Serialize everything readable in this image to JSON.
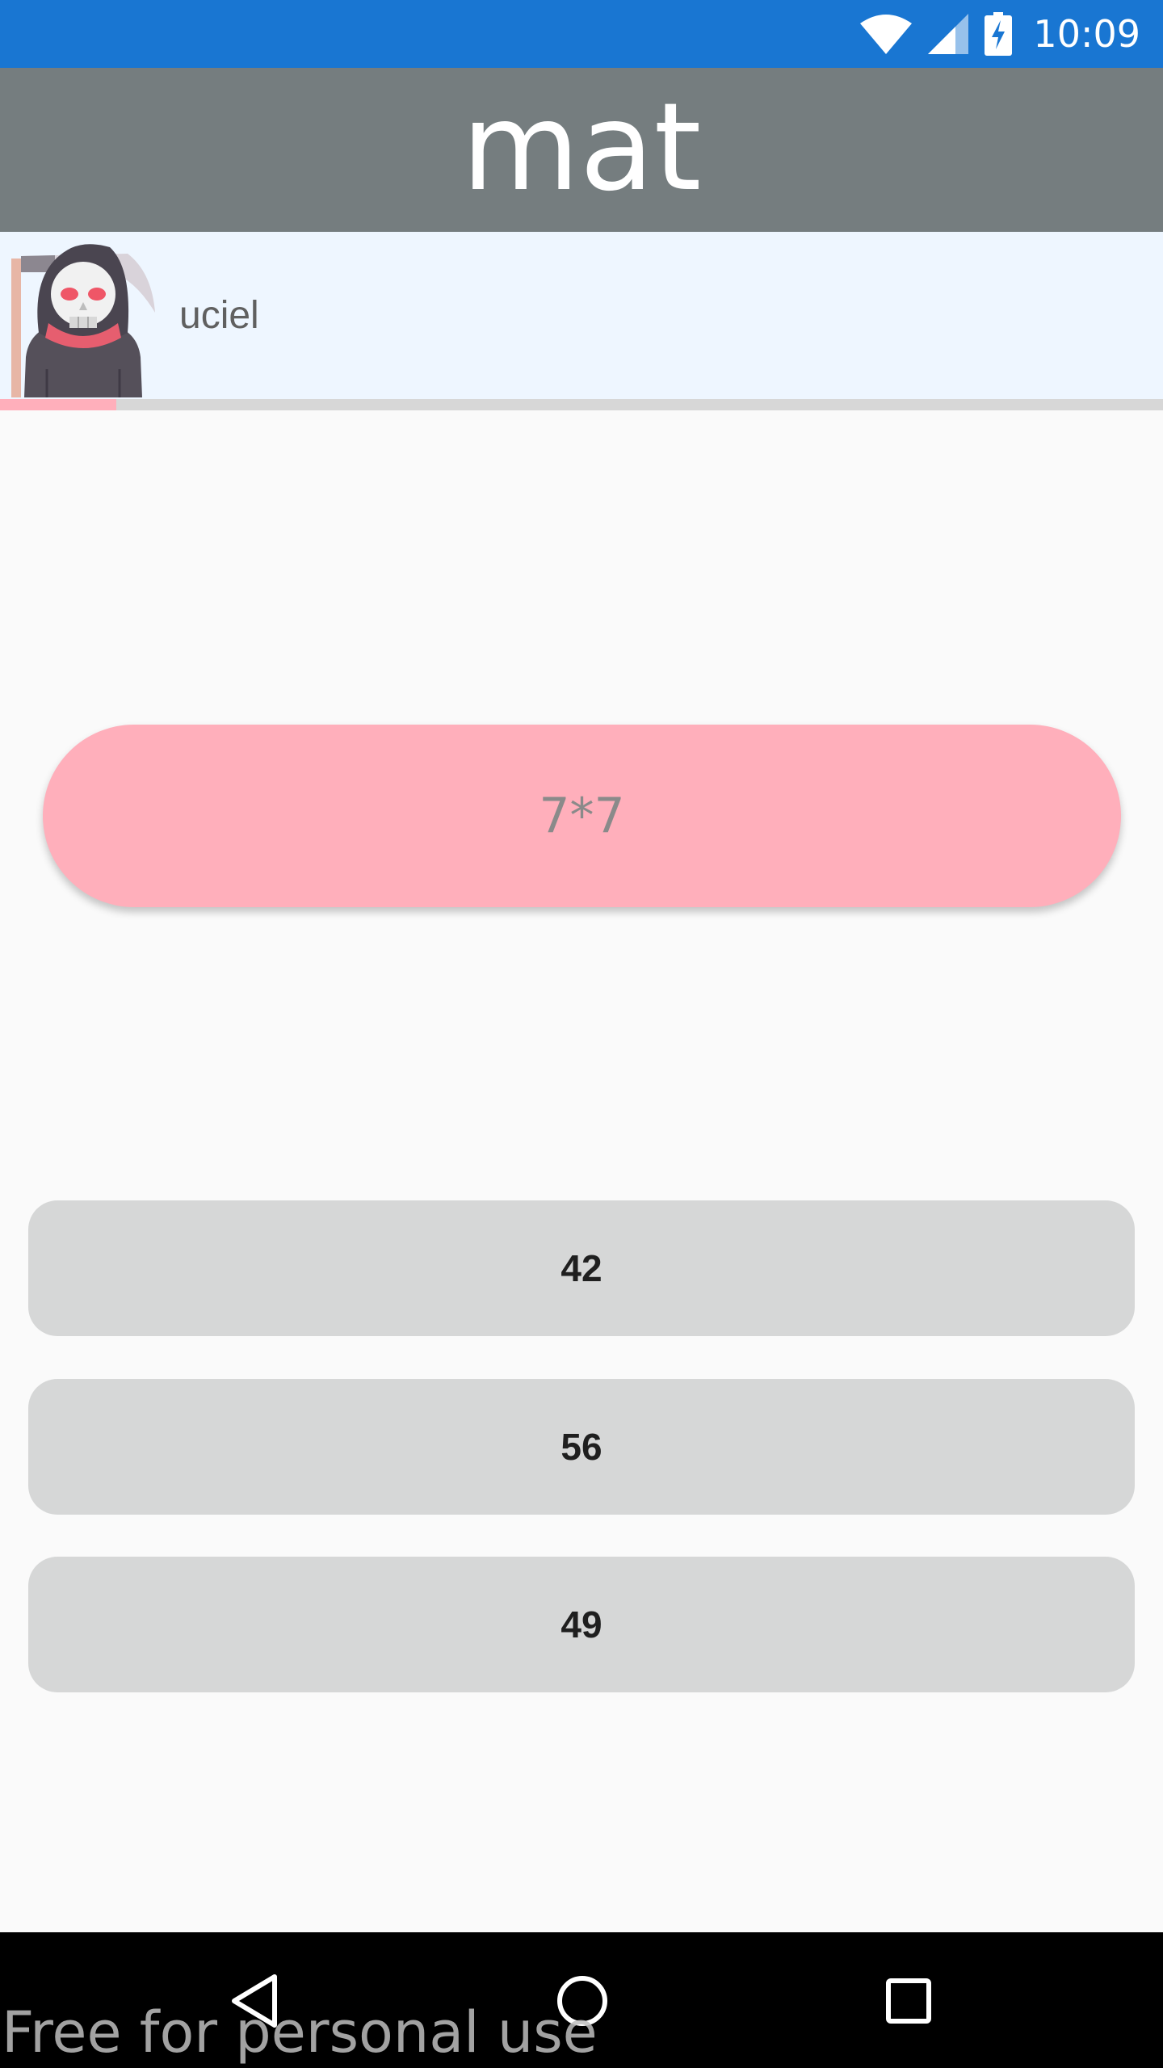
{
  "status_bar": {
    "time": "10:09",
    "icons": [
      "wifi-icon",
      "cell-signal-icon",
      "battery-charging-icon"
    ]
  },
  "app_bar": {
    "title": "mat"
  },
  "user": {
    "name": "uciel",
    "avatar_icon": "grim-reaper-avatar"
  },
  "progress": {
    "fraction": 0.1
  },
  "question": {
    "text": "7*7"
  },
  "answers": [
    {
      "label": "42"
    },
    {
      "label": "56"
    },
    {
      "label": "49"
    }
  ],
  "nav_bar": {
    "icons": [
      "back-icon",
      "home-icon",
      "recents-icon"
    ]
  },
  "watermark": "Free for personal use",
  "colors": {
    "status_bar": "#1976d2",
    "app_bar": "#757d7f",
    "user_row": "#eef6ff",
    "accent_pink": "#ffafbb",
    "answer_bg": "#d6d7d7",
    "nav_bar": "#000000"
  }
}
